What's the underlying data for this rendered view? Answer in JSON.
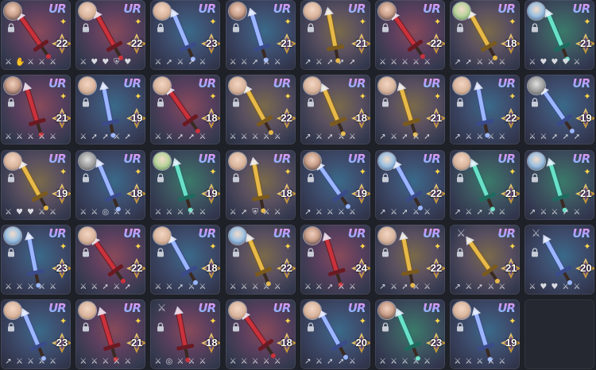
{
  "colors": {
    "background": "#1f2128",
    "rarity_gradient": [
      "#ff9ad8",
      "#b69aff",
      "#6fd3ff"
    ],
    "star": "#ffd84a",
    "level_text": "#ffffff"
  },
  "rarity_label": "UR",
  "cards": [
    {
      "level": "22",
      "theme": "red",
      "portrait": "dark",
      "weapon": "red-blade",
      "skills": [
        "sword-icon",
        "hand-icon",
        "sword-icon",
        "sword-icon",
        "sword-icon"
      ]
    },
    {
      "level": "22",
      "theme": "red",
      "portrait": "light",
      "weapon": "red-claw",
      "skills": [
        "sword-icon",
        "heart-icon",
        "heart-icon",
        "shield-icon",
        "heart-icon"
      ]
    },
    {
      "level": "23",
      "theme": "blue",
      "portrait": "light",
      "weapon": "silver-wand",
      "skills": [
        "sword-icon",
        "arrow-icon",
        "sword-icon",
        "arrow-icon",
        "sword-icon"
      ]
    },
    {
      "level": "21",
      "theme": "blue",
      "portrait": "dark",
      "weapon": "violet-shield",
      "skills": [
        "sword-icon",
        "sword-icon",
        "arrow-icon",
        "sword-icon",
        "sword-icon"
      ]
    },
    {
      "level": "21",
      "theme": "gold",
      "portrait": "light",
      "weapon": "silver-chalice",
      "skills": [
        "lance-icon",
        "sword-icon",
        "arrow-icon",
        "arrow-icon",
        "arrow-icon"
      ]
    },
    {
      "level": "22",
      "theme": "red",
      "portrait": "dark",
      "weapon": "fire-tome",
      "skills": [
        "sword-icon",
        "sword-icon",
        "sword-icon",
        "sword-icon",
        "sword-icon"
      ]
    },
    {
      "level": "18",
      "theme": "gold",
      "portrait": "green",
      "weapon": "gold-ring",
      "skills": [
        "lance-icon",
        "arrow-icon",
        "sword-icon",
        "sword-icon",
        "sword-icon"
      ]
    },
    {
      "level": "21",
      "theme": "teal",
      "portrait": "blue",
      "weapon": "blue-idol",
      "skills": [
        "sword-icon",
        "heart-icon",
        "heart-icon",
        "heart-icon",
        "sword-icon"
      ]
    },
    {
      "level": "21",
      "theme": "red",
      "portrait": "dark",
      "weapon": "pink-sword",
      "skills": [
        "sword-icon",
        "sword-icon",
        "sword-icon",
        "sword-icon",
        "sword-icon"
      ]
    },
    {
      "level": "19",
      "theme": "blue",
      "portrait": "light",
      "weapon": "flail",
      "skills": [
        "sword-icon",
        "arrow-icon",
        "arrow-icon",
        "sword-icon",
        "arrow-icon"
      ]
    },
    {
      "level": "18",
      "theme": "red",
      "portrait": "light",
      "weapon": "crimson-spear",
      "skills": [
        "sword-icon",
        "sword-icon",
        "arrow-icon",
        "arrow-icon",
        "sword-icon"
      ]
    },
    {
      "level": "22",
      "theme": "gold",
      "portrait": "light",
      "weapon": "golden-staff",
      "skills": [
        "sword-icon",
        "sword-icon",
        "sword-icon",
        "sword-icon",
        "sword-icon"
      ]
    },
    {
      "level": "18",
      "theme": "gold",
      "portrait": "light",
      "weapon": "gold-scythe",
      "skills": [
        "lance-icon",
        "sword-icon",
        "arrow-icon",
        "sword-icon",
        "sword-icon"
      ]
    },
    {
      "level": "21",
      "theme": "gold",
      "portrait": "light",
      "weapon": "gold-crossbow",
      "skills": [
        "lance-icon",
        "sword-icon",
        "arrow-icon",
        "sword-icon",
        "arrow-icon"
      ]
    },
    {
      "level": "22",
      "theme": "blue",
      "portrait": "light",
      "weapon": "cannon",
      "skills": [
        "lance-icon",
        "sword-icon",
        "sword-icon",
        "sword-icon",
        "sword-icon"
      ]
    },
    {
      "level": "19",
      "theme": "blue",
      "portrait": "gray",
      "weapon": "dark-hammer",
      "skills": [
        "sword-icon",
        "sword-icon",
        "arrow-icon",
        "arrow-icon",
        "arrow-icon"
      ]
    },
    {
      "level": "19",
      "theme": "gold",
      "portrait": "light",
      "weapon": "wood-bow",
      "skills": [
        "sword-icon",
        "heart-icon",
        "heart-icon",
        "sword-icon",
        "sword-icon"
      ]
    },
    {
      "level": "18",
      "theme": "blue",
      "portrait": "gray",
      "weapon": "broadsword",
      "skills": [
        "sword-icon",
        "sword-icon",
        "target-icon",
        "sword-icon",
        "sword-icon"
      ]
    },
    {
      "level": "19",
      "theme": "teal",
      "portrait": "green",
      "weapon": "green-dagger",
      "skills": [
        "sword-icon",
        "sword-icon",
        "sword-icon",
        "sword-icon",
        "sword-icon"
      ]
    },
    {
      "level": "18",
      "theme": "gold",
      "portrait": "light",
      "weapon": "gold-cross",
      "skills": [
        "sword-icon",
        "arrow-icon",
        "shield-icon",
        "sword-icon",
        "sword-icon"
      ]
    },
    {
      "level": "19",
      "theme": "blue",
      "portrait": "dark",
      "weapon": "crystal-lance",
      "skills": [
        "lance-icon",
        "sword-icon",
        "sword-icon",
        "sword-icon",
        "sword-icon"
      ]
    },
    {
      "level": "22",
      "theme": "blue",
      "portrait": "blue",
      "weapon": "ice-spear",
      "skills": [
        "lance-icon",
        "sword-icon",
        "arrow-icon",
        "sword-icon",
        "sword-icon"
      ]
    },
    {
      "level": "21",
      "theme": "teal",
      "portrait": "light",
      "weapon": "jade-blade",
      "skills": [
        "lance-icon",
        "sword-icon",
        "arrow-icon",
        "sword-icon",
        "sword-icon"
      ]
    },
    {
      "level": "21",
      "theme": "teal",
      "portrait": "blue",
      "weapon": "aqua-rapier",
      "skills": [
        "lance-icon",
        "sword-icon",
        "sword-icon",
        "arrow-icon",
        "sword-icon"
      ]
    },
    {
      "level": "23",
      "theme": "blue",
      "portrait": "blue",
      "weapon": "violet-katana",
      "skills": [
        "sword-icon",
        "sword-icon",
        "sword-icon",
        "sword-icon",
        "sword-icon"
      ]
    },
    {
      "level": "22",
      "theme": "red",
      "portrait": "light",
      "weapon": "spiked-mace",
      "skills": [
        "sword-icon",
        "sword-icon",
        "arrow-icon",
        "sword-icon",
        "arrow-icon"
      ]
    },
    {
      "level": "18",
      "theme": "blue",
      "portrait": "light",
      "weapon": "frost-blade",
      "skills": [
        "sword-icon",
        "sword-icon",
        "arrow-icon",
        "sword-icon",
        "sword-icon"
      ]
    },
    {
      "level": "22",
      "theme": "gold",
      "portrait": "blue",
      "weapon": "silver-scissors",
      "skills": [
        "sword-icon",
        "sword-icon",
        "sword-icon",
        "sword-icon",
        "sword-icon"
      ]
    },
    {
      "level": "24",
      "theme": "red",
      "portrait": "dark",
      "weapon": "ruby-claw",
      "skills": [
        "sword-icon",
        "sword-icon",
        "arrow-icon",
        "sword-icon",
        "sword-icon"
      ]
    },
    {
      "level": "22",
      "theme": "gold",
      "portrait": "light",
      "weapon": "gold-cross-staff",
      "skills": [
        "lance-icon",
        "sword-icon",
        "arrow-icon",
        "sword-icon",
        "sword-icon"
      ]
    },
    {
      "level": "21",
      "theme": "gold",
      "portrait": "none",
      "weapon": "gold-cross-staff",
      "skills": [
        "lance-icon",
        "sword-icon",
        "arrow-icon",
        "sword-icon",
        "sword-icon"
      ]
    },
    {
      "level": "20",
      "theme": "blue",
      "portrait": "none",
      "weapon": "double-axe",
      "skills": [
        "sword-icon",
        "heart-icon",
        "heart-icon",
        "sword-icon",
        "sword-icon"
      ]
    },
    {
      "level": "23",
      "theme": "blue",
      "portrait": "light",
      "weapon": "white-trident",
      "skills": [
        "lance-icon",
        "sword-icon",
        "sword-icon",
        "sword-icon",
        "sword-icon"
      ]
    },
    {
      "level": "21",
      "theme": "red",
      "portrait": "light",
      "weapon": "red-halberd",
      "skills": [
        "sword-icon",
        "sword-icon",
        "sword-icon",
        "sword-icon",
        "sword-icon"
      ]
    },
    {
      "level": "18",
      "theme": "red",
      "portrait": "none",
      "weapon": "red-polearm",
      "skills": [
        "sword-icon",
        "target-icon",
        "sword-icon",
        "sword-icon",
        "sword-icon"
      ]
    },
    {
      "level": "18",
      "theme": "red",
      "portrait": "light",
      "weapon": "boxing-gloves",
      "skills": [
        "sword-icon",
        "sword-icon",
        "sword-icon",
        "sword-icon",
        "sword-icon"
      ]
    },
    {
      "level": "20",
      "theme": "blue",
      "portrait": "light",
      "weapon": "dark-hook",
      "skills": [
        "lance-icon",
        "sword-icon",
        "arrow-icon",
        "arrow-icon",
        "sword-icon"
      ]
    },
    {
      "level": "23",
      "theme": "teal",
      "portrait": "dark",
      "weapon": "teal-shield",
      "skills": [
        "sword-icon",
        "sword-icon",
        "sword-icon",
        "sword-icon",
        "sword-icon"
      ]
    },
    {
      "level": "19",
      "theme": "blue",
      "portrait": "light",
      "weapon": "blue-sword",
      "skills": [
        "sword-icon",
        "sword-icon",
        "sword-icon",
        "sword-icon",
        "sword-icon"
      ]
    },
    {
      "level": "",
      "theme": "empty",
      "portrait": "none",
      "weapon": "none",
      "skills": []
    }
  ]
}
